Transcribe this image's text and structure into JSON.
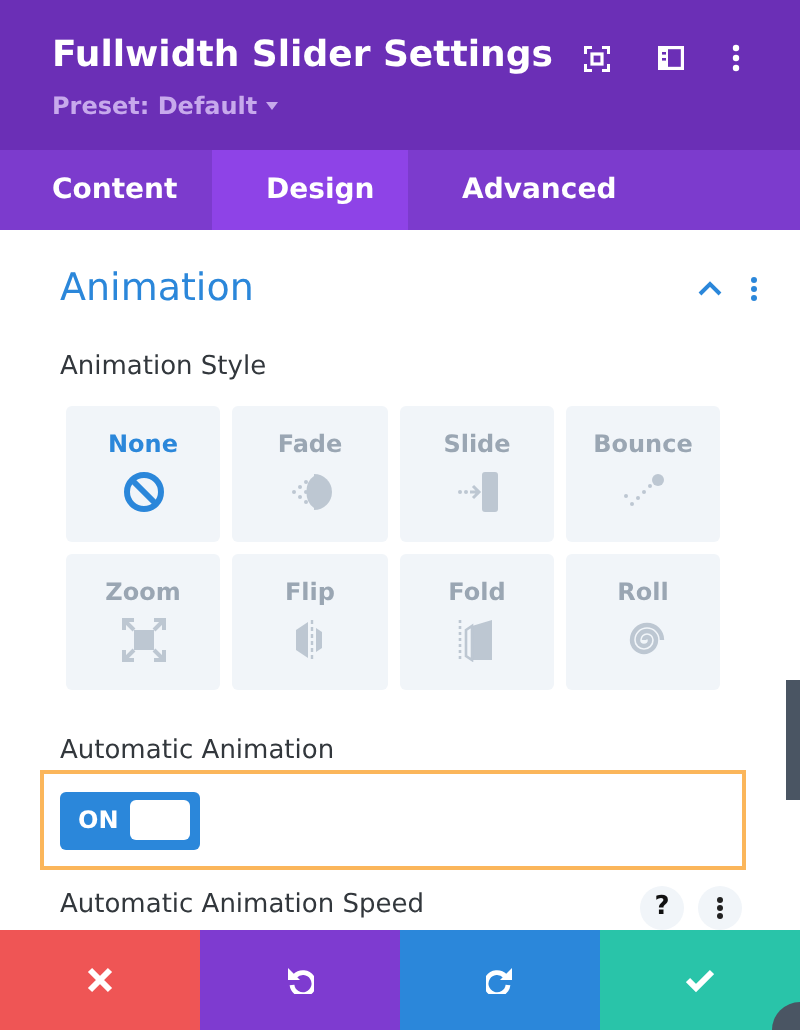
{
  "header": {
    "title": "Fullwidth Slider Settings",
    "preset": "Preset: Default"
  },
  "tabs": [
    {
      "label": "Content",
      "selected": false
    },
    {
      "label": "Design",
      "selected": true
    },
    {
      "label": "Advanced",
      "selected": false
    }
  ],
  "section": {
    "title": "Animation",
    "expanded": true
  },
  "animation_style": {
    "label": "Animation Style",
    "options": [
      {
        "label": "None",
        "kind": "none",
        "selected": true
      },
      {
        "label": "Fade",
        "kind": "fade",
        "selected": false
      },
      {
        "label": "Slide",
        "kind": "slide",
        "selected": false
      },
      {
        "label": "Bounce",
        "kind": "bounce",
        "selected": false
      },
      {
        "label": "Zoom",
        "kind": "zoom",
        "selected": false
      },
      {
        "label": "Flip",
        "kind": "flip",
        "selected": false
      },
      {
        "label": "Fold",
        "kind": "fold",
        "selected": false
      },
      {
        "label": "Roll",
        "kind": "roll",
        "selected": false
      }
    ]
  },
  "automatic_animation": {
    "label": "Automatic Animation",
    "toggle_text": "ON",
    "on": true
  },
  "speed": {
    "label": "Automatic Animation Speed",
    "help": "?"
  },
  "footer": [
    {
      "kind": "cancel"
    },
    {
      "kind": "undo"
    },
    {
      "kind": "redo"
    },
    {
      "kind": "save"
    }
  ]
}
